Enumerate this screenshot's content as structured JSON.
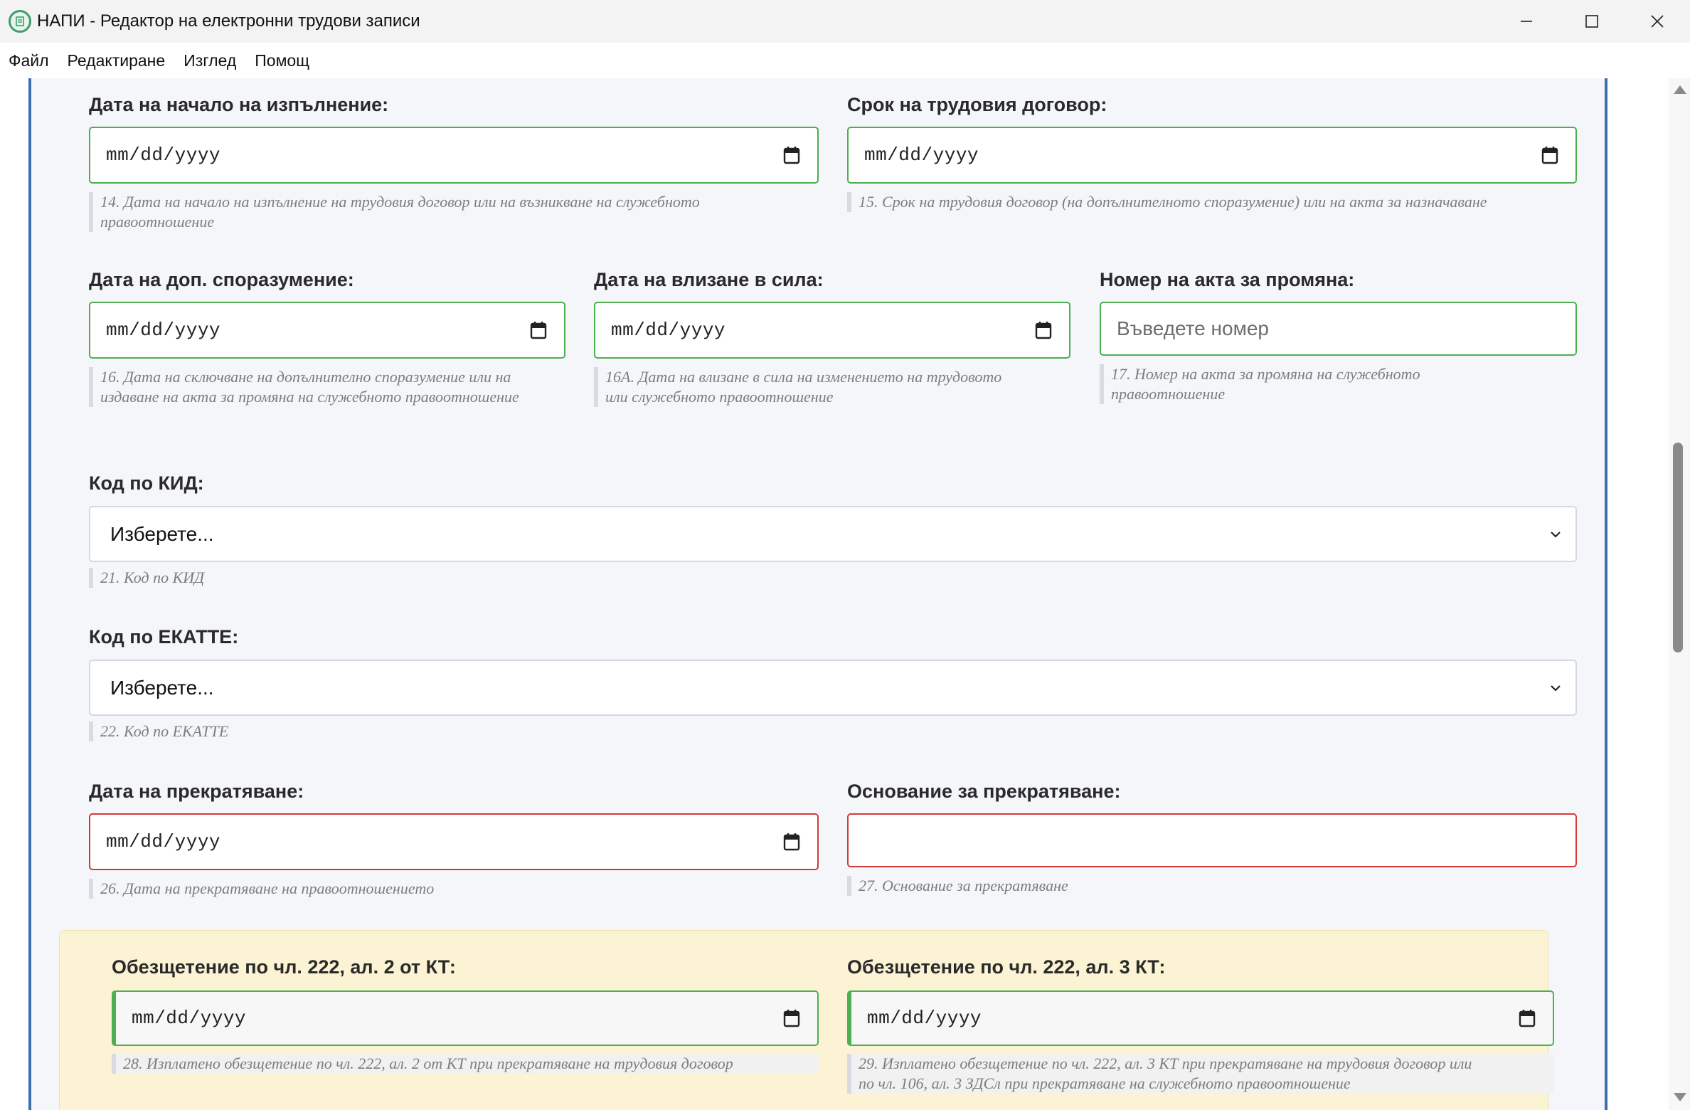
{
  "window": {
    "title": "НАПИ - Редактор на електронни трудови записи"
  },
  "menu": {
    "items": [
      "Файл",
      "Редактиране",
      "Изглед",
      "Помощ"
    ]
  },
  "form": {
    "start_date": {
      "label": "Дата на начало на изпълнение:",
      "value": "mm/dd/yyyy",
      "hint_line1": "14. Дата на начало на изпълнение на трудовия договор или на възникване на служебното",
      "hint_line2": "правоотношение"
    },
    "contract_term": {
      "label": "Срок на трудовия договор:",
      "value": "mm/dd/yyyy",
      "hint_line1": "15. Срок на трудовия договор (на допълнителното споразумение) или на акта за назначаване",
      "hint_line2": ""
    },
    "supplementary_agreement_date": {
      "label": "Дата на доп. споразумение:",
      "value": "mm/dd/yyyy",
      "hint_line1": "16. Дата на сключване на допълнително споразумение или на",
      "hint_line2": "издаване на акта за промяна на служебното правоотношение"
    },
    "effective_date": {
      "label": "Дата на влизане в сила:",
      "value": "mm/dd/yyyy",
      "hint_line1": "16А. Дата на влизане в сила на изменението на трудовото",
      "hint_line2": "или служебното правоотношение"
    },
    "change_act_number": {
      "label": "Номер на акта за промяна:",
      "placeholder": "Въведете номер",
      "hint_line1": "17. Номер на акта за промяна на служебното",
      "hint_line2": "правоотношение"
    },
    "kid_code": {
      "label": "Код по КИД:",
      "selected": "Изберете...",
      "hint": "21. Код по КИД"
    },
    "ekatte_code": {
      "label": "Код по ЕКАТТЕ:",
      "selected": "Изберете...",
      "hint": "22. Код по ЕКАТТЕ"
    },
    "termination_date": {
      "label": "Дата на прекратяване:",
      "value": "mm/dd/yyyy",
      "hint": "26. Дата на прекратяване на правоотношението"
    },
    "termination_basis": {
      "label": "Основание за прекратяване:",
      "value": "",
      "hint": "27. Основание за прекратяване"
    },
    "compensation_222_2": {
      "label": "Обезщетение по чл. 222, ал. 2 от КТ:",
      "value": "mm/dd/yyyy",
      "hint": "28. Изплатено обезщетение по чл. 222, ал. 2 от КТ при прекратяване на трудовия договор"
    },
    "compensation_222_3": {
      "label": "Обезщетение по чл. 222, ал. 3 КТ:",
      "value": "mm/dd/yyyy",
      "hint_line1": "29. Изплатено обезщетение по чл. 222, ал. 3 КТ при прекратяване на трудовия договор или",
      "hint_line2": "по чл. 106, ал. 3 ЗДСл при прекратяване на служебното правоотношение"
    }
  },
  "colors": {
    "valid_border": "#4caf50",
    "invalid_border": "#d33a3a",
    "panel_border": "#3c6db0",
    "highlight_box": "#fbf3d4"
  },
  "icons": {
    "app": "napi-app-icon",
    "date_picker": "calendar-icon",
    "dropdown": "chevron-down-icon"
  }
}
